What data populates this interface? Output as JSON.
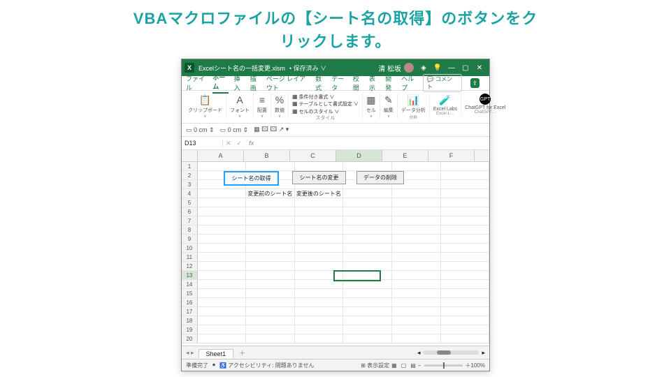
{
  "headline_l1": "VBAマクロファイルの【シート名の取得】のボタンをク",
  "headline_l2": "リックします。",
  "title": {
    "filename": "Excelシート名の一括変更.xlsm",
    "saved": "• 保存済み ∨",
    "user": "清 松坂"
  },
  "tabs": {
    "file": "ファイル",
    "home": "ホーム",
    "insert": "挿入",
    "draw": "描画",
    "layout": "ページ レイアウト",
    "formula": "数式",
    "data": "データ",
    "review": "校閲",
    "view": "表示",
    "dev": "開発",
    "help": "ヘルプ",
    "comment": "コメント"
  },
  "ribbon": {
    "clip": "クリップボード",
    "font": "フォント",
    "align": "配置",
    "num": "数値",
    "cond": "条件付き書式 ∨",
    "tbl": "テーブルとして書式設定 ∨",
    "cellst": "セルのスタイル ∨",
    "stylelbl": "スタイル",
    "cell": "セル",
    "edit": "編集",
    "analyze": "データ分析",
    "analyzegrp": "分析",
    "labs": "Excel Labs",
    "labsgrp": "Excel L…",
    "gpt": "ChatGPT for Excel",
    "gptgrp": "ChatGPT…"
  },
  "namebox": "D13",
  "columns": [
    "A",
    "B",
    "C",
    "D",
    "E",
    "F"
  ],
  "buttons": {
    "get": "シート名の取得",
    "change": "シート名の変更",
    "del": "データの削除"
  },
  "labels": {
    "before": "変更前のシート名",
    "after": "変更後のシート名"
  },
  "sheet": "Sheet1",
  "status": {
    "ready": "準備完了",
    "acc": "アクセシビリティ: 問題ありません",
    "disp": "表示設定",
    "zoom": "100%"
  }
}
